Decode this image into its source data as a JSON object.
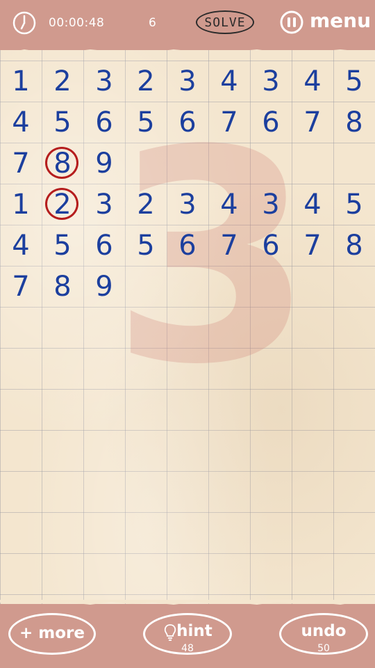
{
  "header": {
    "timer": "00:00:48",
    "moves": "6",
    "solve_label": "SOLVE",
    "menu_label": "menu"
  },
  "board": {
    "stage": "3",
    "rows": [
      [
        "1",
        "2",
        "3",
        "2",
        "3",
        "4",
        "3",
        "4",
        "5"
      ],
      [
        "4",
        "5",
        "6",
        "5",
        "6",
        "7",
        "6",
        "7",
        "8"
      ],
      [
        "7",
        "8",
        "9",
        "",
        "",
        "",
        "",
        "",
        ""
      ],
      [
        "1",
        "2",
        "3",
        "2",
        "3",
        "4",
        "3",
        "4",
        "5"
      ],
      [
        "4",
        "5",
        "6",
        "5",
        "6",
        "7",
        "6",
        "7",
        "8"
      ],
      [
        "7",
        "8",
        "9",
        "",
        "",
        "",
        "",
        "",
        ""
      ]
    ],
    "selected": [
      [
        2,
        1
      ],
      [
        3,
        1
      ]
    ]
  },
  "footer": {
    "more_label": "+ more",
    "hint_label": "hint",
    "hint_count": "48",
    "undo_label": "undo",
    "undo_count": "50"
  },
  "colors": {
    "bar": "#d09a8e",
    "paper": "#f4e6cf",
    "digit": "#1c3f9e",
    "selection": "#b51d1d"
  }
}
